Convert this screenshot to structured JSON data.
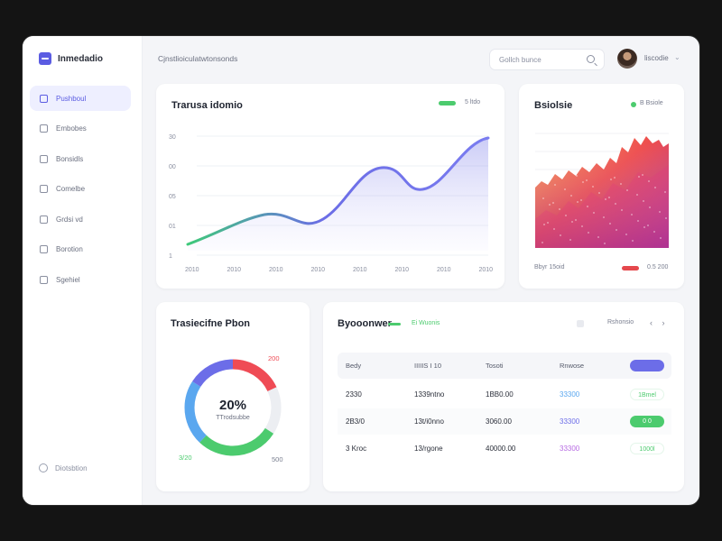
{
  "brand": {
    "name": "Inmedadio"
  },
  "sidebar": {
    "items": [
      {
        "label": "Pushboul",
        "active": true,
        "icon": "home-icon"
      },
      {
        "label": "Embobes",
        "active": false,
        "icon": "document-icon"
      },
      {
        "label": "Bonsidls",
        "active": false,
        "icon": "inbox-icon"
      },
      {
        "label": "Comelbe",
        "active": false,
        "icon": "folder-icon"
      },
      {
        "label": "Grdsi vd",
        "active": false,
        "icon": "chart-icon"
      },
      {
        "label": "Borotion",
        "active": false,
        "icon": "people-icon"
      },
      {
        "label": "Sgehiel",
        "active": false,
        "icon": "file-icon"
      }
    ],
    "settings_label": "Diotsbtion"
  },
  "header": {
    "breadcrumb": "Cjnstlioiculatwtonsonds",
    "search_placeholder": "Gollch bunce",
    "user_name": "liscodie",
    "caret": "⌄"
  },
  "line_card": {
    "title": "Trarusa idomio",
    "legend_label": "5 ltdo",
    "legend_color": "#4ccb6e",
    "y_ticks": [
      "30",
      "00",
      "05",
      "01",
      "1"
    ],
    "x_ticks": [
      "2010",
      "2010",
      "2010",
      "2010",
      "2010",
      "2010",
      "2010",
      "2010"
    ],
    "colors": {
      "start": "#3fc97a",
      "mid": "#6b6de6",
      "end": "#7a7cf0",
      "fill": "#eceaff"
    }
  },
  "heat_card": {
    "title": "Bsiolsie",
    "legend_dot": "#4ccb6e",
    "legend_label": "B Bsiole",
    "footer_left": "Bbyr 15oid",
    "footer_right": "0.5 200",
    "footer_color": "#e5484d"
  },
  "donut_card": {
    "title": "Trasiecifne Pbon",
    "center_value": "20%",
    "center_label": "TTrodsubbe",
    "label_top": "200",
    "label_left": "3/20",
    "label_right": "500",
    "segments": [
      {
        "value": 0.18,
        "color": "#ef4b55"
      },
      {
        "value": 0.16,
        "color": "#eceef2"
      },
      {
        "value": 0.28,
        "color": "#4ccb6e"
      },
      {
        "value": 0.22,
        "color": "#5aa7ef"
      },
      {
        "value": 0.16,
        "color": "#6c6de8"
      }
    ]
  },
  "table_card": {
    "title": "Byooonwer",
    "badge": "Ei Wuonis",
    "filter_label": "Rshonsio",
    "pager": "‹ ›",
    "columns": [
      "Bedy",
      "IIIIIS I 10",
      "Tosoti",
      "Rnwose"
    ],
    "rows": [
      {
        "c1": "2330",
        "c2": "1339ntno",
        "c3": "1BB0.00",
        "c4": "33300",
        "status": "1Bmel",
        "status_style": "outline",
        "c4_color": "#5aa7ef"
      },
      {
        "c1": "2B3/0",
        "c2": "13t/i0nno",
        "c3": "3060.00",
        "c4": "33300",
        "status": "0 0",
        "status_style": "green",
        "c4_color": "#6c6de8"
      },
      {
        "c1": "3 Kroc",
        "c2": "13/rgone",
        "c3": "40000.00",
        "c4": "33300",
        "status": "1000l",
        "status_style": "outline",
        "c4_color": "#b76be3"
      }
    ],
    "head_pill_color": "#6c6de8"
  }
}
